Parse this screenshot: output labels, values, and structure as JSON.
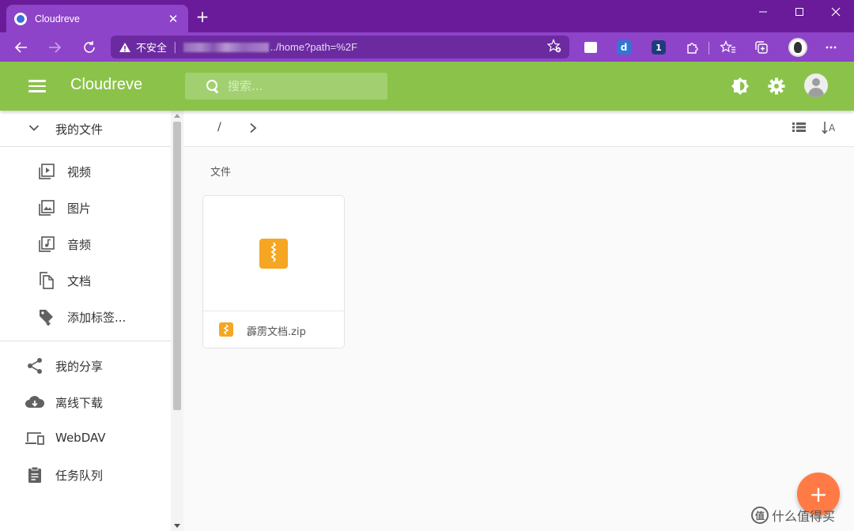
{
  "browser": {
    "tab_title": "Cloudreve",
    "tab_close": "✕",
    "new_tab": "+",
    "security_label": "不安全",
    "url_visible_path": "../home?path=%2F"
  },
  "app": {
    "title": "Cloudreve",
    "search_placeholder": "搜索..."
  },
  "sidebar": {
    "my_files": "我的文件",
    "categories": [
      {
        "label": "视频",
        "icon": "video-icon"
      },
      {
        "label": "图片",
        "icon": "image-icon"
      },
      {
        "label": "音频",
        "icon": "audio-icon"
      },
      {
        "label": "文档",
        "icon": "document-icon"
      },
      {
        "label": "添加标签...",
        "icon": "add-tag-icon"
      }
    ],
    "items": [
      {
        "label": "我的分享",
        "icon": "share-icon"
      },
      {
        "label": "离线下载",
        "icon": "cloud-download-icon"
      },
      {
        "label": "WebDAV",
        "icon": "devices-icon"
      },
      {
        "label": "任务队列",
        "icon": "clipboard-icon"
      }
    ]
  },
  "breadcrumb": {
    "root": "/"
  },
  "main": {
    "section_label": "文件",
    "files": [
      {
        "name": "霹雳文档.zip",
        "type": "zip"
      }
    ]
  },
  "fab_label": "+",
  "watermark": {
    "logo": "值",
    "text": "什么值得买"
  },
  "colors": {
    "browser_tabbar": "#6a1b9a",
    "browser_toolbar": "#8e44c9",
    "appbar": "#8bc34a",
    "fab": "#ff7a45",
    "zip": "#f5a623"
  }
}
